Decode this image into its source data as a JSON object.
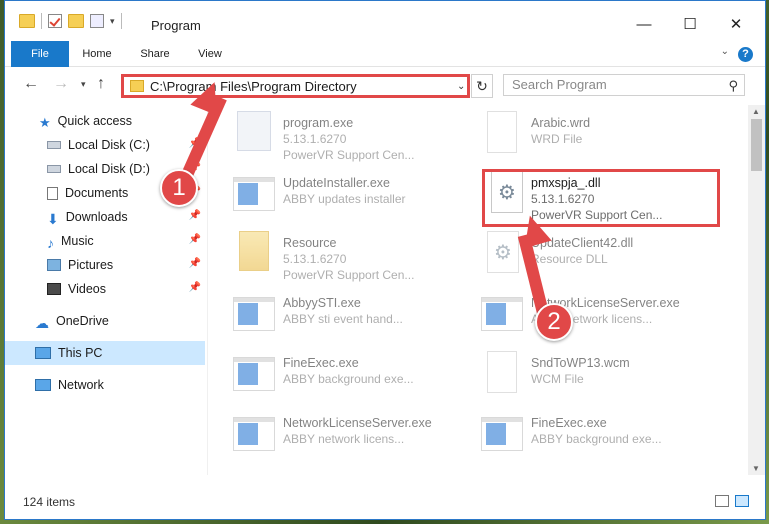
{
  "window": {
    "title": "Program"
  },
  "ribbon": {
    "tabs": [
      "File",
      "Home",
      "Share",
      "View"
    ],
    "help_label": "?"
  },
  "address": {
    "path": "C:\\Program Files\\Program Directory"
  },
  "search": {
    "placeholder": "Search Program"
  },
  "sidebar": {
    "items": [
      {
        "label": "Quick access",
        "icon": "star-icon"
      },
      {
        "label": "Local Disk (C:)",
        "icon": "drive-icon"
      },
      {
        "label": "Local Disk (D:)",
        "icon": "drive-icon"
      },
      {
        "label": "Documents",
        "icon": "documents-icon"
      },
      {
        "label": "Downloads",
        "icon": "download-icon"
      },
      {
        "label": "Music",
        "icon": "music-icon"
      },
      {
        "label": "Pictures",
        "icon": "pictures-icon"
      },
      {
        "label": "Videos",
        "icon": "videos-icon"
      },
      {
        "label": "OneDrive",
        "icon": "cloud-icon"
      },
      {
        "label": "This PC",
        "icon": "pc-icon"
      },
      {
        "label": "Network",
        "icon": "network-icon"
      }
    ]
  },
  "files": [
    {
      "name": "program.exe",
      "line2": "5.13.1.6270",
      "line3": "PowerVR Support Cen..."
    },
    {
      "name": "Arabic.wrd",
      "line2": "WRD File",
      "line3": ""
    },
    {
      "name": "UpdateInstaller.exe",
      "line2": "ABBY updates installer",
      "line3": ""
    },
    {
      "name": "pmxspja_.dll",
      "line2": "5.13.1.6270",
      "line3": "PowerVR Support Cen..."
    },
    {
      "name": "Resource",
      "line2": "5.13.1.6270",
      "line3": "PowerVR Support Cen..."
    },
    {
      "name": "UpdateClient42.dll",
      "line2": "Resource DLL",
      "line3": ""
    },
    {
      "name": "AbbyySTI.exe",
      "line2": "ABBY sti event hand...",
      "line3": ""
    },
    {
      "name": "NetworkLicenseServer.exe",
      "line2": "ABBY network licens...",
      "line3": ""
    },
    {
      "name": "FineExec.exe",
      "line2": "ABBY background exe...",
      "line3": ""
    },
    {
      "name": "SndToWP13.wcm",
      "line2": "WCM File",
      "line3": ""
    },
    {
      "name": "NetworkLicenseServer.exe",
      "line2": "ABBY network licens...",
      "line3": ""
    },
    {
      "name": "FineExec.exe",
      "line2": "ABBY background exe...",
      "line3": ""
    }
  ],
  "status": {
    "count": "124 items"
  },
  "callouts": {
    "step1": "1",
    "step2": "2"
  },
  "colors": {
    "accent": "#1979ca",
    "highlight": "#e14848"
  }
}
